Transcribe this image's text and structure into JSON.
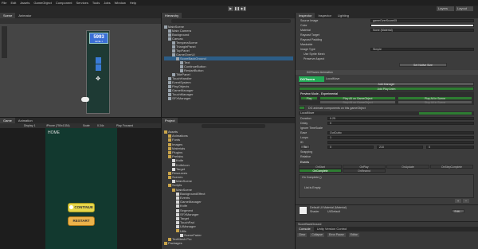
{
  "menu": [
    "File",
    "Edit",
    "Assets",
    "GameObject",
    "Component",
    "Services",
    "Tools",
    "Jobs",
    "Window",
    "Help"
  ],
  "toolbar": {
    "layers": "Layers",
    "layout": "Layout"
  },
  "scene": {
    "tab_scene": "Scene",
    "tab_animator": "Animator",
    "mode": "Global",
    "score_label": "SCORE",
    "score_value": "5993",
    "level": "LEVEL 1"
  },
  "game": {
    "tab_game": "Game",
    "tab_animation": "Animation",
    "display": "Display 1",
    "resolution": "iPhone (750x1334)",
    "scale": "Scale",
    "scale_val": "0.34x",
    "play_focused": "Play Focused",
    "home": "HOME",
    "continue": "CONTINUE",
    "restart": "RESTART"
  },
  "hierarchy": {
    "tab": "Hierarchy",
    "items": [
      "MainScene",
      "Main Camera",
      "Background",
      "Canvas",
      "TemperaScene",
      "TrianglePanel",
      "TopPanel",
      "GameOverUI",
      "ScoreBackGround",
      "Text",
      "ContinueButton",
      "RestartButton",
      "TitlePanel",
      "TouchHandler",
      "EventSystem",
      "PlayObjects",
      "GameManager",
      "TouchManager",
      "SFXManager"
    ]
  },
  "project": {
    "tab": "Project",
    "items": [
      "Assets",
      "Animations",
      "Fonts",
      "Images",
      "Materials",
      "Plugins",
      "Prefabs",
      "Knife",
      "KnifeIcon",
      "Target",
      "Resources",
      "Scenes",
      "MainScene",
      "Scripts",
      "MainScene",
      "BackgroundEffect",
      "Events",
      "GameManager",
      "Knife",
      "Segment",
      "SFXManager",
      "Target",
      "TouchPad",
      "UIManager",
      "Utils",
      "SceneFader",
      "TextMesh Pro",
      "Packages"
    ]
  },
  "inspector": {
    "tabs": [
      "Inspector",
      "Inspector",
      "Lighting"
    ],
    "fields": [
      "Source Image",
      "Color",
      "Material",
      "Raycast Target",
      "Raycast Padding",
      "Maskable",
      "Image Type",
      "Use Sprite Mesh",
      "Preserve Aspect"
    ],
    "values": {
      "source": "gameOverScore05",
      "material": "None (Material)",
      "image_type": "Simple"
    },
    "set_native": "Set Native Size"
  },
  "dotween": {
    "title": "DOTween Animation",
    "component": "LocalMove",
    "add_manager": "Add Manager",
    "add_play": "Add Play Anim",
    "preview": "Preview Mode - Experimental",
    "play": "Play",
    "play_game": "Play All on GameObject",
    "play_scene": "Play All in Scene",
    "stop_game": "Stop All on GameObject",
    "stop_scene": "Stop All in Scene",
    "fill_info": "DG animate components on this gameObject",
    "target_type": "LocalMove",
    "duration": "Duration",
    "duration_val": "0.25",
    "delay": "Delay",
    "delay_val": "0",
    "ignore": "Ignore TimeScale",
    "ease": "Ease",
    "ease_val": "OutCubic",
    "loops": "Loops",
    "loops_val": "1",
    "id": "ID",
    "to": "To",
    "to_vals": [
      "0",
      "210",
      "0"
    ],
    "relative": "Relative",
    "snapping": "Snapping",
    "events": "Events",
    "event_tabs": [
      "OnStart",
      "OnPlay",
      "OnUpdate",
      "OnStepComplete",
      "OnComplete",
      "OnRewind"
    ],
    "on_complete": "On Complete ()",
    "list_empty": "List is Empty"
  },
  "material": {
    "name": "Default UI Material (Material)",
    "shader": "UI/Default",
    "edit": "Edit..."
  },
  "console": {
    "title": "ScoreBackGround",
    "tabs": [
      "Console",
      "Unity Version Control"
    ],
    "buttons": [
      "Clear",
      "Collapse",
      "Error Pause",
      "Editor"
    ]
  }
}
